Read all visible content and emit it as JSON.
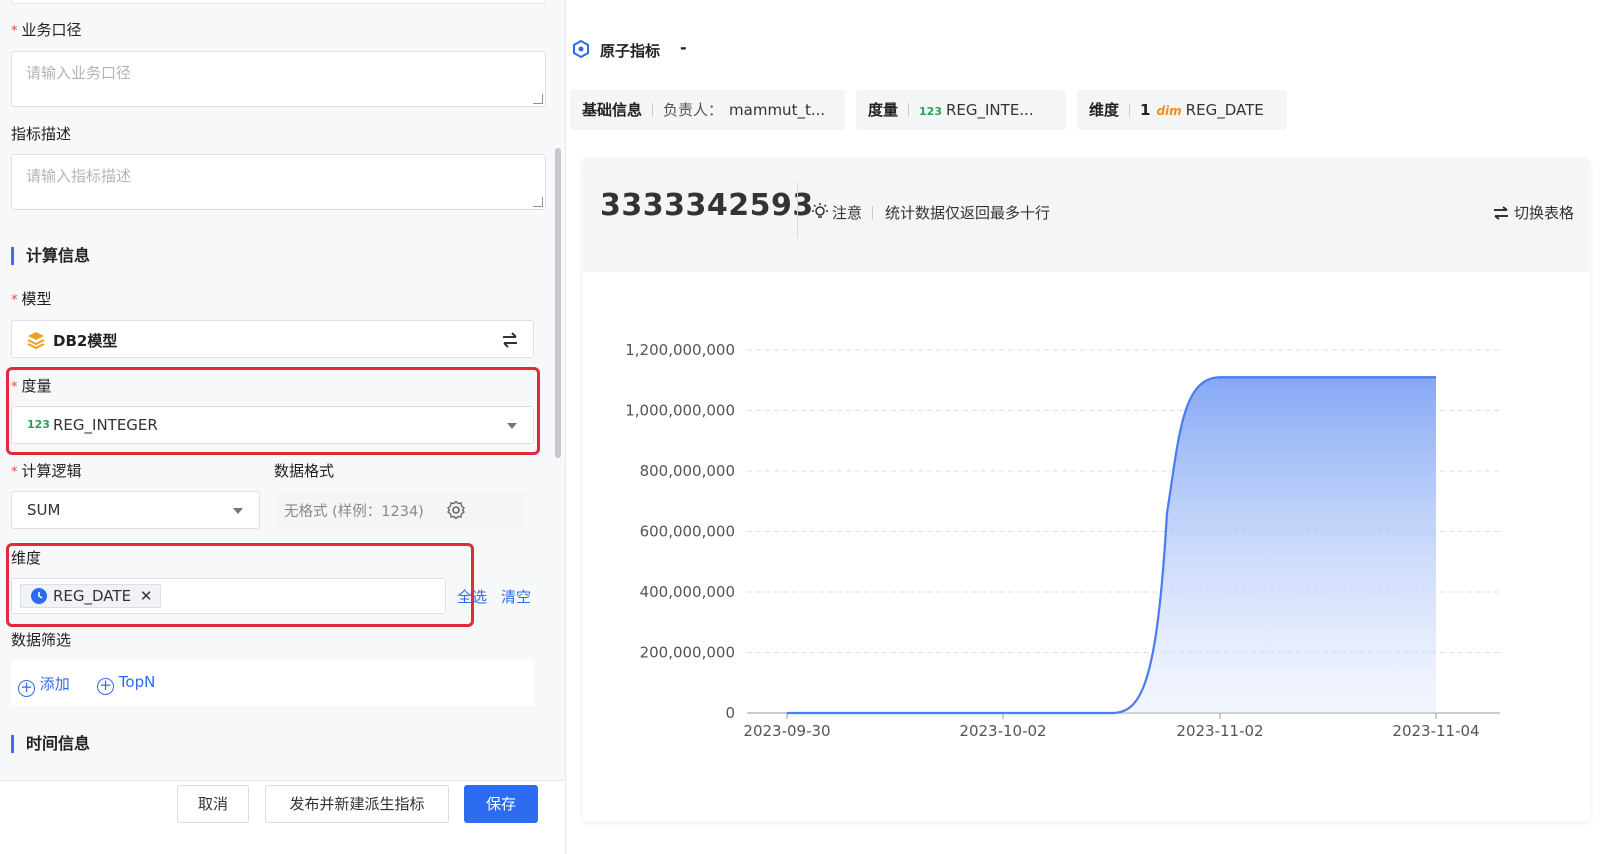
{
  "form": {
    "biz_caliber": {
      "label": "业务口径",
      "placeholder": "请输入业务口径"
    },
    "metric_desc": {
      "label": "指标描述",
      "placeholder": "请输入指标描述"
    },
    "calc_section": "计算信息",
    "model": {
      "label": "模型",
      "value": "DB2模型"
    },
    "measure": {
      "label": "度量",
      "badge": "123",
      "value": "REG_INTEGER"
    },
    "calc_logic": {
      "label": "计算逻辑",
      "value": "SUM"
    },
    "data_format": {
      "label": "数据格式",
      "value": "无格式 (样例：1234)"
    },
    "dimension": {
      "label": "维度",
      "tag": "REG_DATE",
      "select_all": "全选",
      "clear": "清空"
    },
    "data_filter": {
      "label": "数据筛选",
      "add": "添加",
      "topn": "TopN"
    },
    "time_section": "时间信息"
  },
  "footer": {
    "cancel": "取消",
    "publish": "发布并新建派生指标",
    "save": "保存"
  },
  "preview": {
    "title": "原子指标",
    "title_suffix": "-",
    "basic_info": {
      "label": "基础信息",
      "owner_label": "负责人：",
      "owner": "mammut_t..."
    },
    "measure_chip": {
      "label": "度量",
      "badge": "123",
      "value": "REG_INTE..."
    },
    "dim_chip": {
      "label": "维度",
      "count": "1",
      "badge": "dim",
      "value": "REG_DATE"
    },
    "total": "3333342593",
    "notice_label": "注意",
    "notice_text": "统计数据仅返回最多十行",
    "toggle_table": "切换表格"
  },
  "colors": {
    "accent": "#2d6cf0",
    "required": "#e8473f",
    "highlight": "#e02b3a",
    "line": "#4a7cf0"
  },
  "chart_data": {
    "type": "area",
    "categories": [
      "2023-09-30",
      "2023-10-02",
      "2023-11-02",
      "2023-11-04"
    ],
    "values": [
      0,
      0,
      1110000000,
      1110000000
    ],
    "ylim": [
      0,
      1200000000
    ],
    "yticks": [
      0,
      200000000,
      400000000,
      600000000,
      800000000,
      1000000000,
      1200000000
    ],
    "ytick_labels": [
      "0",
      "200,000,000",
      "400,000,000",
      "600,000,000",
      "800,000,000",
      "1,000,000,000",
      "1,200,000,000"
    ],
    "grid": true
  }
}
